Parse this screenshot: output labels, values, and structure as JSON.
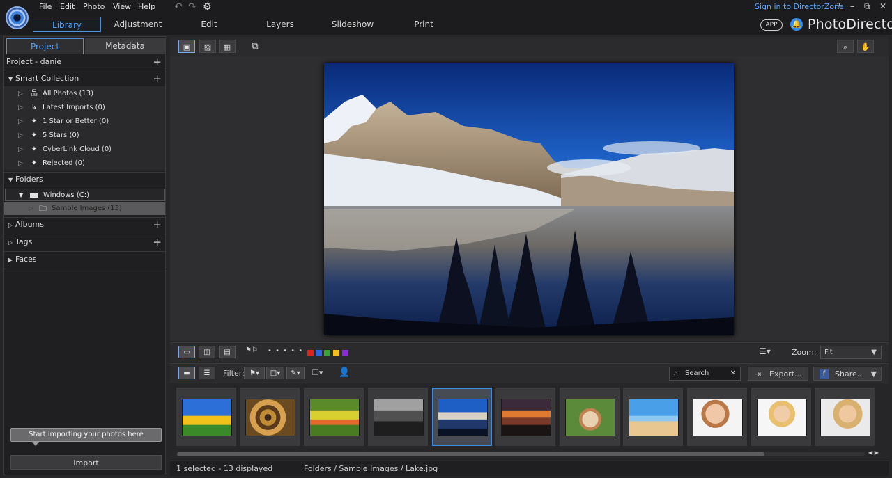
{
  "menu": [
    "File",
    "Edit",
    "Photo",
    "View",
    "Help"
  ],
  "modes": [
    "Library",
    "Adjustment",
    "Edit",
    "Layers",
    "Slideshow",
    "Print"
  ],
  "signin": "Sign in to DirectorZone",
  "help": "?",
  "app_badge": "APP",
  "brand": "PhotoDirector",
  "panel_tabs": {
    "project": "Project",
    "metadata": "Metadata"
  },
  "project_label": "Project - danie",
  "smart_collection": {
    "label": "Smart Collection",
    "items": [
      "All Photos (13)",
      "Latest Imports (0)",
      "1 Star or Better (0)",
      "5 Stars (0)",
      "CyberLink Cloud (0)",
      "Rejected (0)"
    ]
  },
  "folders": {
    "label": "Folders",
    "drive": "Windows (C:)",
    "sub": "Sample Images (13)"
  },
  "albums": "Albums",
  "tags": "Tags",
  "faces": "Faces",
  "hint": "Start importing your photos here",
  "import": "Import",
  "strip": {
    "stars": "• • • • •",
    "zoom_label": "Zoom:",
    "zoom_value": "Fit",
    "filter_label": "Filter:",
    "search": "Search",
    "export": "Export...",
    "share": "Share..."
  },
  "colors": {
    "accent": "#3d8de8",
    "labels": [
      "#e0211c",
      "#2d66e0",
      "#3aa23a",
      "#f0c020",
      "#8a2ad8"
    ]
  },
  "status": {
    "count": "1 selected - 13 displayed",
    "path": "Folders / Sample Images / Lake.jpg"
  }
}
